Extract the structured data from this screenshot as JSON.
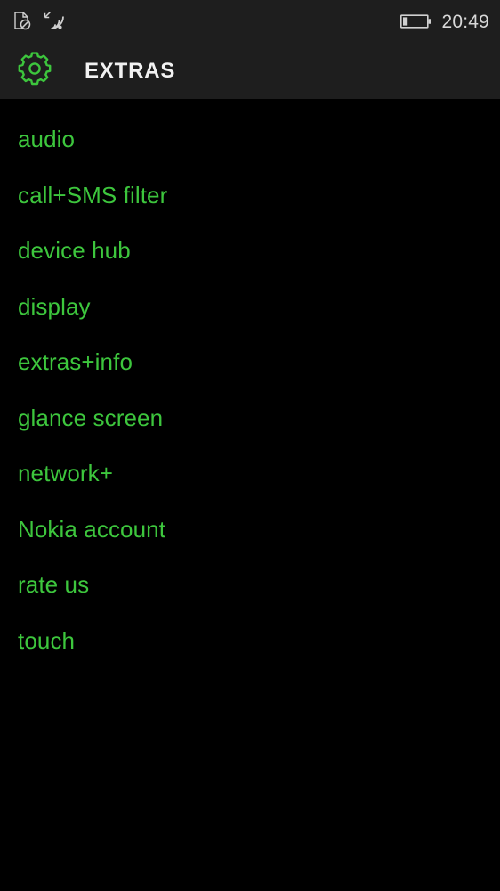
{
  "status_bar": {
    "background_color": "#1e1e1e",
    "icons": [
      {
        "name": "no-sim-icon",
        "label": "no SIM card"
      },
      {
        "name": "wifi-data-icon",
        "label": "Wi-Fi connected with data transfer"
      },
      {
        "name": "battery-low-icon",
        "label": "battery low"
      }
    ],
    "clock": "20:49",
    "clock_color": "#d8d8d8"
  },
  "header": {
    "background_color": "#1e1e1e",
    "icon": "gear-icon",
    "icon_color": "#3dc63d",
    "title": "EXTRAS",
    "title_color": "#f2f2f2"
  },
  "list": {
    "background_color": "#000000",
    "item_color": "#3dc63d",
    "items": [
      {
        "label": "audio"
      },
      {
        "label": "call+SMS filter"
      },
      {
        "label": "device hub"
      },
      {
        "label": "display"
      },
      {
        "label": "extras+info"
      },
      {
        "label": "glance screen"
      },
      {
        "label": "network+"
      },
      {
        "label": "Nokia account"
      },
      {
        "label": "rate us"
      },
      {
        "label": "touch"
      }
    ]
  }
}
